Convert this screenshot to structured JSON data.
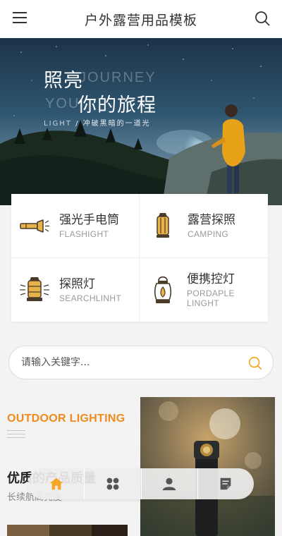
{
  "header": {
    "title": "户外露营用品模板",
    "menu_icon": "menu-icon",
    "search_icon": "search-icon"
  },
  "banner": {
    "headline_line1": "照亮",
    "headline_line2": "你的旅程",
    "ghost_line1": "JOURNEY",
    "ghost_line2": "YOU",
    "tagline_en": "LIGHT",
    "tagline_sep": " / ",
    "tagline_cn": "冲破黑暗的一道光"
  },
  "categories": [
    {
      "name_cn": "强光手电筒",
      "name_en": "FLASHIGHT",
      "icon": "flashlight-icon"
    },
    {
      "name_cn": "露营探照",
      "name_en": "CAMPING",
      "icon": "camping-lantern-icon"
    },
    {
      "name_cn": "探照灯",
      "name_en": "SEARCHLINHT",
      "icon": "searchlight-icon"
    },
    {
      "name_cn": "便携控灯",
      "name_en": "PORDAPLE LINGHT",
      "icon": "portable-lantern-icon"
    }
  ],
  "search": {
    "placeholder": "请输入关键字...",
    "value": "",
    "icon": "search-icon"
  },
  "section": {
    "eyebrow": "OUTDOOR LIGHTING",
    "title": "优质的产品质量",
    "subtitle": "长续航高亮度"
  },
  "tabbar": {
    "items": [
      {
        "icon": "home-icon",
        "active": true
      },
      {
        "icon": "category-grid-icon",
        "active": false
      },
      {
        "icon": "user-icon",
        "active": false
      },
      {
        "icon": "notes-icon",
        "active": false
      }
    ]
  },
  "colors": {
    "accent": "#f08a1b",
    "search_icon": "#f5a623",
    "text_dark": "#333333",
    "text_muted": "#999999",
    "icon_brown": "#4a3b2a",
    "icon_gold": "#e8b44a"
  }
}
